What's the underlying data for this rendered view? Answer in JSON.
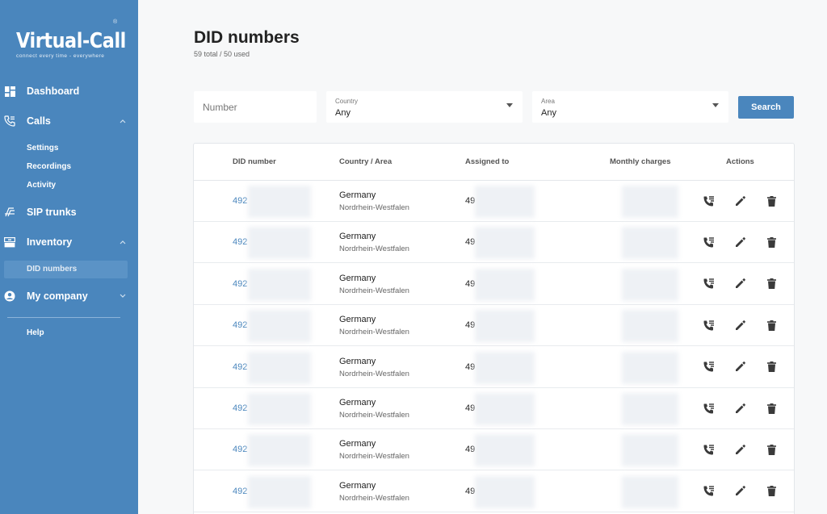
{
  "brand": {
    "name": "Virtual-Call",
    "tagline": "connect every time - everywhere",
    "registered": "®"
  },
  "sidebar": {
    "dashboard": "Dashboard",
    "calls": "Calls",
    "calls_sub": [
      "Settings",
      "Recordings",
      "Activity"
    ],
    "sip_trunks": "SIP trunks",
    "inventory": "Inventory",
    "inventory_sub": [
      "DID numbers"
    ],
    "my_company": "My company",
    "help": "Help"
  },
  "header": {
    "title": "DID numbers",
    "subtitle": "59 total / 50 used"
  },
  "filters": {
    "number_placeholder": "Number",
    "country_label": "Country",
    "country_value": "Any",
    "area_label": "Area",
    "area_value": "Any",
    "search_label": "Search"
  },
  "table": {
    "columns": [
      "DID number",
      "Country / Area",
      "Assigned to",
      "Monthly charges",
      "Actions"
    ],
    "rows": [
      {
        "did": "492",
        "country": "Germany",
        "area": "Nordrhein-Westfalen",
        "assigned": "49"
      },
      {
        "did": "492",
        "country": "Germany",
        "area": "Nordrhein-Westfalen",
        "assigned": "49"
      },
      {
        "did": "492",
        "country": "Germany",
        "area": "Nordrhein-Westfalen",
        "assigned": "49"
      },
      {
        "did": "492",
        "country": "Germany",
        "area": "Nordrhein-Westfalen",
        "assigned": "49"
      },
      {
        "did": "492",
        "country": "Germany",
        "area": "Nordrhein-Westfalen",
        "assigned": "49"
      },
      {
        "did": "492",
        "country": "Germany",
        "area": "Nordrhein-Westfalen",
        "assigned": "49"
      },
      {
        "did": "492",
        "country": "Germany",
        "area": "Nordrhein-Westfalen",
        "assigned": "49"
      },
      {
        "did": "492",
        "country": "Germany",
        "area": "Nordrhein-Westfalen",
        "assigned": "49"
      }
    ]
  },
  "icons": {
    "row_actions": [
      "phone-forward-icon",
      "edit-pencil-icon",
      "trash-icon"
    ]
  },
  "colors": {
    "sidebar": "#4a86bd",
    "accent": "#4a86bd",
    "active_item": "#5b93c6"
  }
}
